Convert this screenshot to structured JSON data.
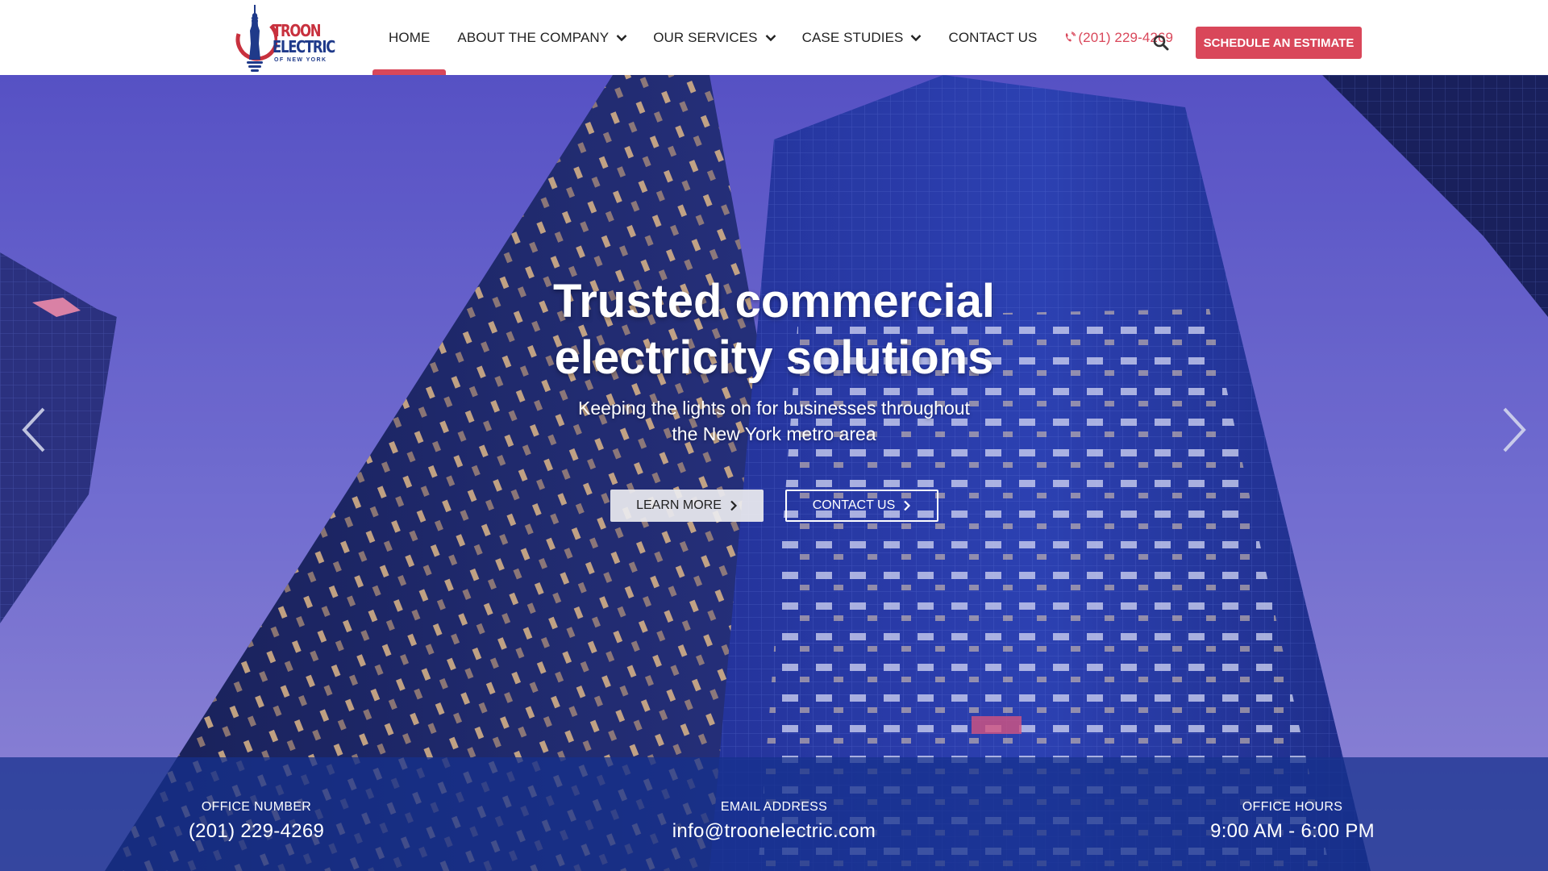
{
  "header": {
    "logo": {
      "line1": "TROON",
      "line2": "ELECTRIC",
      "line3": "OF NEW YORK"
    },
    "nav": {
      "home": "HOME",
      "about": "ABOUT THE COMPANY",
      "services": "OUR SERVICES",
      "cases": "CASE STUDIES",
      "contact": "CONTACT US",
      "phone": "(201) 229-4269"
    },
    "cta": "SCHEDULE AN ESTIMATE",
    "accent_color": "#d9475a"
  },
  "hero": {
    "title_line1": "Trusted commercial",
    "title_line2": "electricity solutions",
    "subtitle_line1": "Keeping the lights on for businesses throughout",
    "subtitle_line2": "the New York metro area",
    "learn_more": "LEARN MORE",
    "contact": "CONTACT US"
  },
  "info": {
    "office_label": "OFFICE NUMBER",
    "office_value": "(201) 229-4269",
    "email_label": "EMAIL ADDRESS",
    "email_value": "info@troonelectric.com",
    "hours_label": "OFFICE HOURS",
    "hours_value": "9:00 AM - 6:00 PM"
  }
}
